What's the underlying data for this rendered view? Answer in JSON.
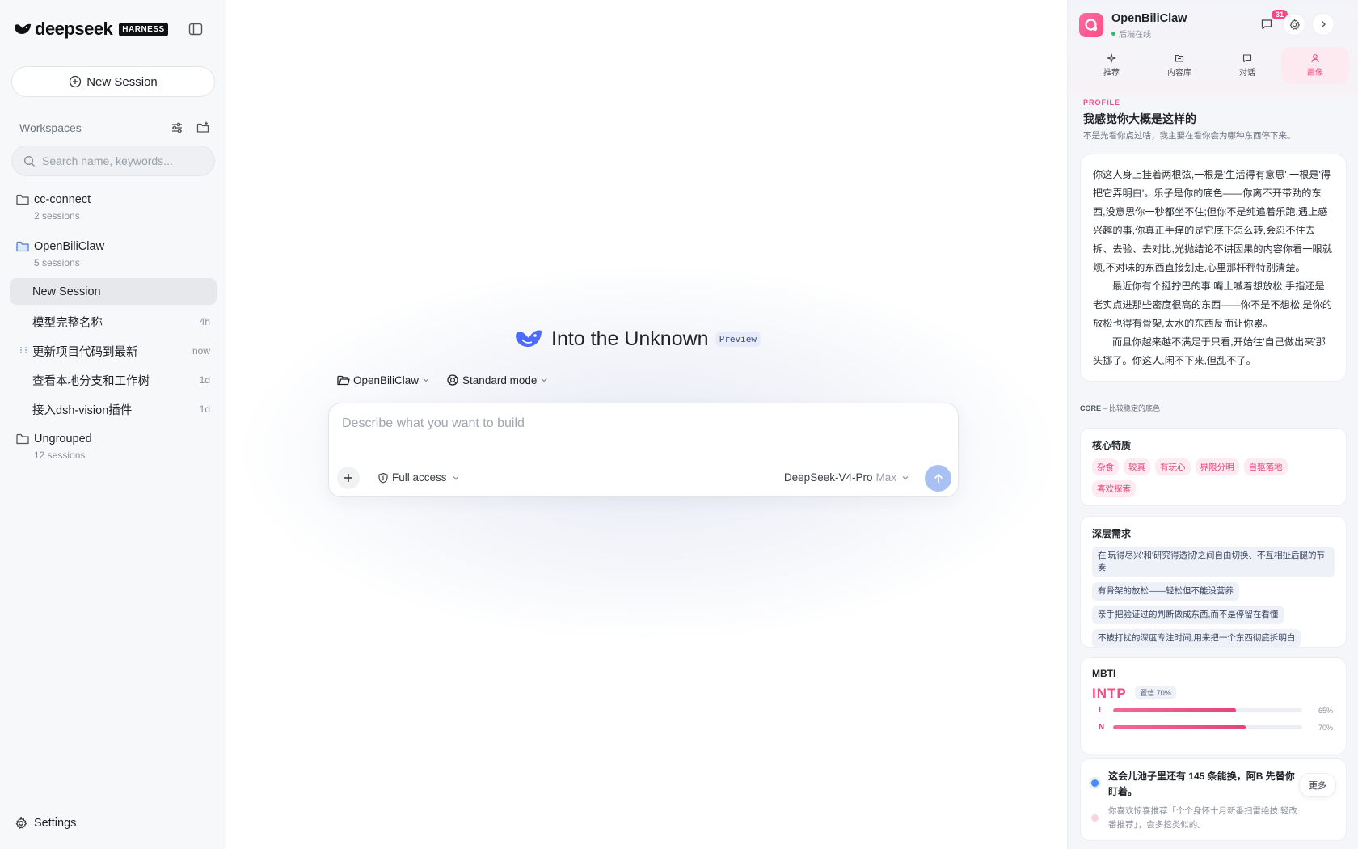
{
  "sidebar": {
    "logo_text": "deepseek",
    "badge": "HARNESS",
    "new_session": "New Session",
    "workspaces_title": "Workspaces",
    "search_placeholder": "Search name, keywords...",
    "folders": [
      {
        "name": "cc-connect",
        "count": "2 sessions"
      },
      {
        "name": "OpenBiliClaw",
        "count": "5 sessions"
      },
      {
        "name": "Ungrouped",
        "count": "12 sessions"
      }
    ],
    "sessions": [
      {
        "name": "New Session",
        "time": ""
      },
      {
        "name": "模型完整名称",
        "time": "4h"
      },
      {
        "name": "更新项目代码到最新",
        "time": "now"
      },
      {
        "name": "查看本地分支和工作树",
        "time": "1d"
      },
      {
        "name": "接入dsh-vision插件",
        "time": "1d"
      }
    ],
    "settings": "Settings"
  },
  "main": {
    "title": "Into the Unknown",
    "preview_tag": "Preview",
    "project_chip": "OpenBiliClaw",
    "mode_chip": "Standard mode",
    "prompt_placeholder": "Describe what you want to build",
    "access": "Full access",
    "model": "DeepSeek-V4-Pro",
    "model_level": "Max"
  },
  "panel": {
    "app_name": "OpenBiliClaw",
    "status": "后端在线",
    "notif_count": "31",
    "tabs": [
      "推荐",
      "内容库",
      "对话",
      "画像"
    ],
    "active_tab": "画像",
    "profile_label": "PROFILE",
    "profile_title": "我感觉你大概是这样的",
    "profile_sub": "不是光看你点过啥，我主要在看你会为哪种东西停下来。",
    "essay": [
      "你这人身上挂着两根弦,一根是'生活得有意思',一根是'得把它弄明白'。乐子是你的底色——你离不开带劲的东西,没意思你一秒都坐不住;但你不是纯追着乐跑,遇上感兴趣的事,你真正手痒的是它底下怎么转,会忍不住去拆、去验、去对比,光抛结论不讲因果的内容你看一眼就烦,不对味的东西直接划走,心里那杆秤特别清楚。",
      "最近你有个挺拧巴的事:嘴上喊着想放松,手指还是老实点进那些密度很高的东西——你不是不想松,是你的放松也得有骨架,太水的东西反而让你累。",
      "而且你越来越不满足于只看,开始往'自己做出来'那头挪了。你这人,闲不下来,但乱不了。"
    ],
    "core_label": "CORE",
    "core_sub": "– 比较稳定的底色",
    "traits_title": "核心特质",
    "traits": [
      "杂食",
      "较真",
      "有玩心",
      "界限分明",
      "自驱落地",
      "喜欢探索"
    ],
    "needs_title": "深层需求",
    "needs": [
      "在'玩得尽兴'和'研究得透彻'之间自由切换、不互相扯后腿的节奏",
      "有骨架的放松——轻松但不能没营养",
      "亲手把验证过的判断做成东西,而不是停留在看懂",
      "不被打扰的深度专注时间,用来把一个东西彻底拆明白"
    ],
    "mbti_title": "MBTI",
    "mbti_type": "INTP",
    "mbti_conf": "置信 70%",
    "mbti_bars": [
      {
        "letter": "I",
        "value": 0.65,
        "label": "65%"
      },
      {
        "letter": "N",
        "value": 0.7,
        "label": "70%"
      }
    ],
    "footer_line1": "这会儿池子里还有 145 条能换，阿B 先替你盯着。",
    "footer_line2": "你喜欢惊喜推荐「个个身怀十月新番扫雷绝技 轻改番推荐」，会多挖类似的。",
    "more": "更多"
  }
}
